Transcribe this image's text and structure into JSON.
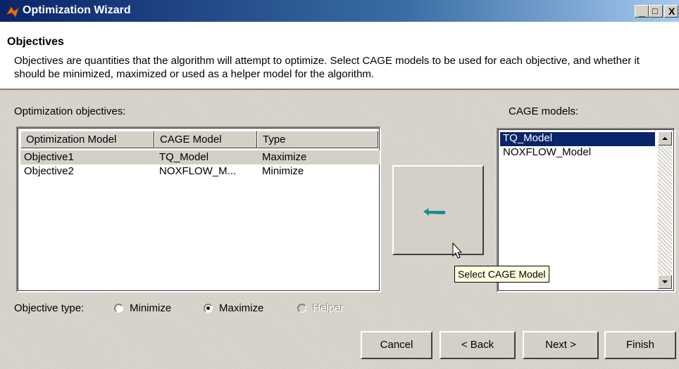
{
  "window": {
    "title": "Optimization Wizard",
    "controls": {
      "minimize": "_",
      "maximize": "□",
      "close": "X"
    }
  },
  "header": {
    "title": "Objectives",
    "description": "Objectives are quantities that the algorithm will attempt to optimize.  Select CAGE models to be used for each objective, and whether it should be minimized, maximized or used as a helper model for the algorithm."
  },
  "objectives": {
    "label": "Optimization objectives:",
    "columns": [
      "Optimization Model",
      "CAGE Model",
      "Type"
    ],
    "rows": [
      {
        "model": "Objective1",
        "cage": "TQ_Model",
        "type": "Maximize",
        "selected": true
      },
      {
        "model": "Objective2",
        "cage": "NOXFLOW_M...",
        "type": "Minimize",
        "selected": false
      }
    ]
  },
  "cage_models": {
    "label": "CAGE models:",
    "items": [
      {
        "name": "TQ_Model",
        "selected": true
      },
      {
        "name": "NOXFLOW_Model",
        "selected": false
      }
    ]
  },
  "select_button": {
    "icon": "arrow-left-icon",
    "tooltip": "Select CAGE Model"
  },
  "objective_type": {
    "label": "Objective type:",
    "options": [
      {
        "label": "Minimize",
        "checked": false,
        "enabled": true
      },
      {
        "label": "Maximize",
        "checked": true,
        "enabled": true
      },
      {
        "label": "Helper",
        "checked": false,
        "enabled": false
      }
    ]
  },
  "buttons": {
    "cancel": "Cancel",
    "back": "< Back",
    "next": "Next >",
    "finish": "Finish"
  },
  "colors": {
    "selection": "#0a246a",
    "face": "#d4d0c8",
    "arrow": "#1a8c8c"
  }
}
